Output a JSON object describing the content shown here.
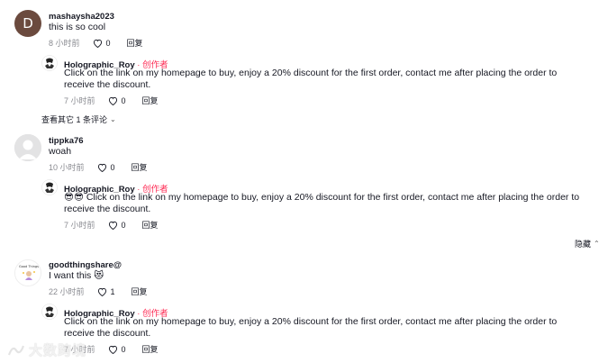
{
  "comments": [
    {
      "avatar_letter": "D",
      "username": "mashaysha2023",
      "text": "this is so cool",
      "time": "8 小时前",
      "likes": "0",
      "reply_label": "回复",
      "reply": {
        "username": "Holographic_Roy",
        "creator_tag": " · 创作者",
        "text": "Click on the link on my homepage to buy, enjoy a 20% discount for the first order, contact me after placing the order to receive the discount.",
        "time": "7 小时前",
        "likes": "0",
        "reply_label": "回复"
      },
      "expand_label": "查看其它 1 条评论"
    },
    {
      "username": "tippka76",
      "text": "woah",
      "time": "10 小时前",
      "likes": "0",
      "reply_label": "回复",
      "reply": {
        "username": "Holographic_Roy",
        "creator_tag": " · 创作者",
        "emoji": "😎😎",
        "text": "Click on the link on my homepage to buy, enjoy a 20% discount for the first order, contact me after placing the order to receive the discount.",
        "time": "7 小时前",
        "likes": "0",
        "reply_label": "回复"
      },
      "collapse_label": "隐藏"
    },
    {
      "username": "goodthingshare@",
      "avatar_caption": "Good Things",
      "text": "I want this 😻",
      "time": "22 小时前",
      "likes": "1",
      "reply_label": "回复",
      "reply": {
        "username": "Holographic_Roy",
        "creator_tag": " · 创作者",
        "text": "Click on the link on my homepage to buy, enjoy a 20% discount for the first order, contact me after placing the order to receive the discount.",
        "time": "7 小时前",
        "likes": "0",
        "reply_label": "回复"
      }
    }
  ],
  "watermark": {
    "text": "大数跨境"
  },
  "colors": {
    "creator": "#fe2c55",
    "meta": "#8a8b91",
    "text": "#161823"
  }
}
